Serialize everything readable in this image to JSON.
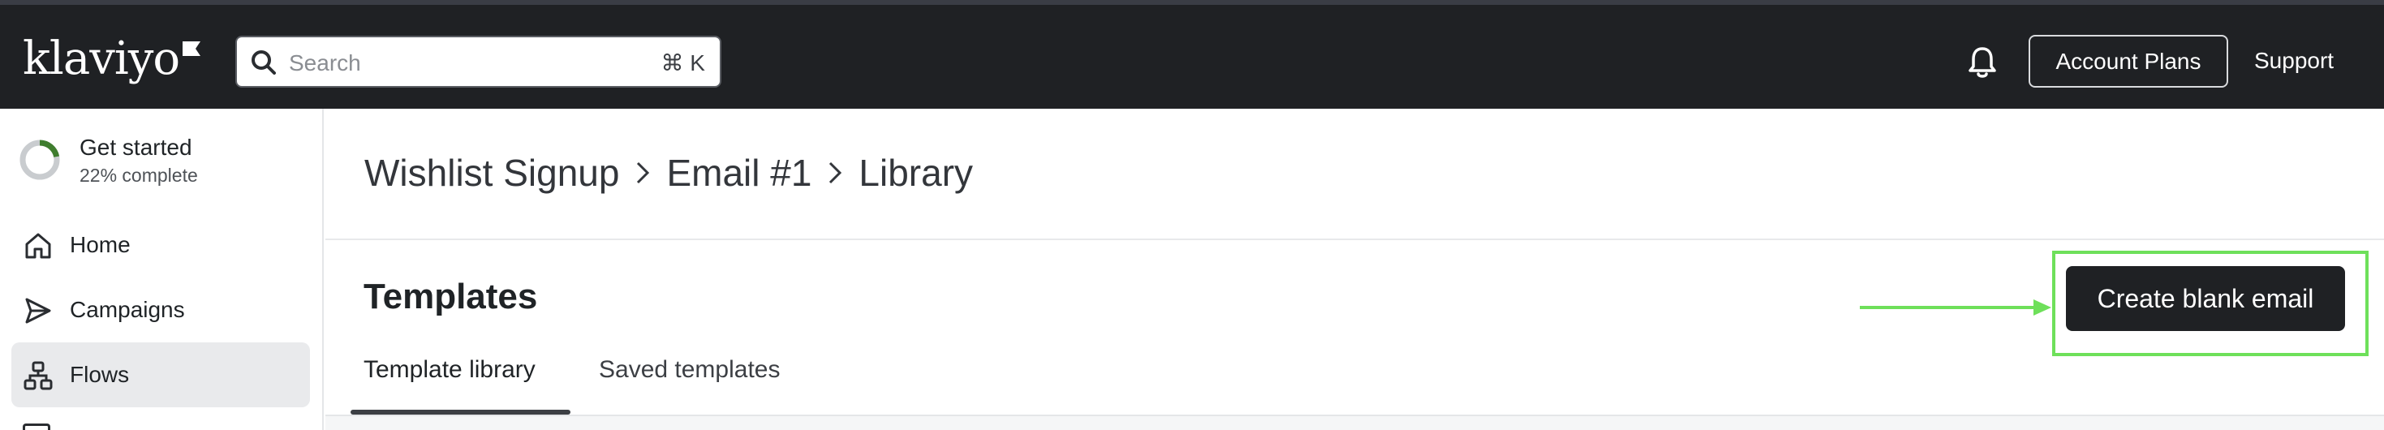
{
  "app": {
    "brand": "klaviyo"
  },
  "header": {
    "search": {
      "placeholder": "Search",
      "shortcut": "⌘ K"
    },
    "account_plans_label": "Account Plans",
    "support_label": "Support"
  },
  "sidebar": {
    "get_started": {
      "title": "Get started",
      "subtitle": "22% complete",
      "progress_fraction": 0.22
    },
    "items": [
      {
        "label": "Home",
        "icon": "home-icon",
        "active": false
      },
      {
        "label": "Campaigns",
        "icon": "send-icon",
        "active": false
      },
      {
        "label": "Flows",
        "icon": "flows-icon",
        "active": true
      }
    ]
  },
  "breadcrumb": {
    "items": [
      "Wishlist Signup",
      "Email #1",
      "Library"
    ]
  },
  "main": {
    "section_title": "Templates",
    "tabs": [
      {
        "label": "Template library",
        "active": true
      },
      {
        "label": "Saved templates",
        "active": false
      }
    ],
    "create_button_label": "Create blank email"
  },
  "colors": {
    "topbar_bg": "#1f2124",
    "highlight": "#6ee05a",
    "progress_accent": "#3f7d2e",
    "active_nav_bg": "#e9eaec"
  }
}
